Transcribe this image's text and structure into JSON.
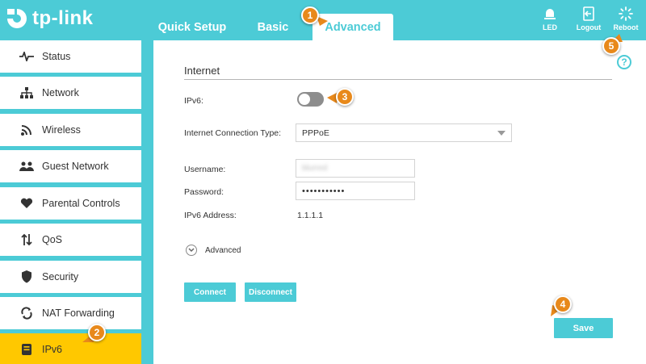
{
  "brand": {
    "name": "tp-link"
  },
  "header": {
    "tabs": [
      {
        "label": "Quick Setup"
      },
      {
        "label": "Basic"
      },
      {
        "label": "Advanced",
        "active": true
      }
    ],
    "tools": [
      {
        "label": "LED",
        "icon": "led-bulb-icon"
      },
      {
        "label": "Logout",
        "icon": "logout-icon"
      },
      {
        "label": "Reboot",
        "icon": "reboot-icon"
      }
    ]
  },
  "sidebar": {
    "items": [
      {
        "label": "Status",
        "icon": "pulse-icon"
      },
      {
        "label": "Network",
        "icon": "network-icon"
      },
      {
        "label": "Wireless",
        "icon": "wifi-icon"
      },
      {
        "label": "Guest Network",
        "icon": "guest-icon"
      },
      {
        "label": "Parental Controls",
        "icon": "heart-icon"
      },
      {
        "label": "QoS",
        "icon": "qos-arrows-icon"
      },
      {
        "label": "Security",
        "icon": "shield-icon"
      },
      {
        "label": "NAT Forwarding",
        "icon": "nat-arrows-icon"
      },
      {
        "label": "IPv6",
        "icon": "ipv6-icon",
        "active": true
      }
    ]
  },
  "main": {
    "section_title": "Internet",
    "ipv6": {
      "label": "IPv6:",
      "enabled": false
    },
    "connection_type": {
      "label": "Internet Connection Type:",
      "value": "PPPoE"
    },
    "username": {
      "label": "Username:",
      "value": "blurred"
    },
    "password": {
      "label": "Password:",
      "value": "•••••••••••"
    },
    "ipv6_address": {
      "label": "IPv6 Address:",
      "value": "1.1.1.1"
    },
    "advanced_toggle": {
      "label": "Advanced"
    },
    "buttons": {
      "connect": "Connect",
      "disconnect": "Disconnect",
      "save": "Save"
    },
    "help_glyph": "?"
  },
  "callouts": [
    "1",
    "2",
    "3",
    "4",
    "5"
  ],
  "colors": {
    "accent": "#4ccbd6",
    "active_nav": "#ffc800",
    "callout": "#e8891b"
  }
}
